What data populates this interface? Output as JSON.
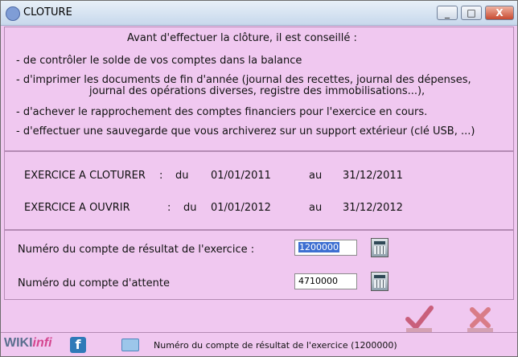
{
  "window": {
    "title": "CLOTURE",
    "controls": [
      "_",
      "□",
      "X"
    ]
  },
  "info": {
    "heading": "Avant d'effectuer la clôture, il est conseillé :",
    "lines": [
      "- de contrôler le solde de vos comptes dans la balance",
      "- d'imprimer les documents de fin d'année (journal des recettes, journal des dépenses,",
      "journal des opérations diverses, registre des immobilisations...),",
      "- d'achever le rapprochement  des comptes financiers pour l'exercice en cours.",
      "- d'effectuer une sauvegarde que vous archiverez sur un support extérieur (clé USB, ...)"
    ]
  },
  "exercises": [
    {
      "label": "EXERCICE A CLOTURER",
      "sep": ":",
      "du": "du",
      "start": "01/01/2011",
      "au": "au",
      "end": "31/12/2011"
    },
    {
      "label": "EXERCICE A OUVRIR",
      "sep": ":",
      "du": "du",
      "start": "01/01/2012",
      "au": "au",
      "end": "31/12/2012"
    }
  ],
  "accounts": {
    "result_label": "Numéro du compte de résultat de l'exercice :",
    "result_value": "1200000",
    "waiting_label": "Numéro du compte d'attente",
    "waiting_value": "4710000"
  },
  "footer": {
    "brand_prefix": "WIKI",
    "brand_suffix": "infi",
    "facebook": "f",
    "status_text": "Numéro du compte de résultat de l'exercice (1200000)"
  }
}
